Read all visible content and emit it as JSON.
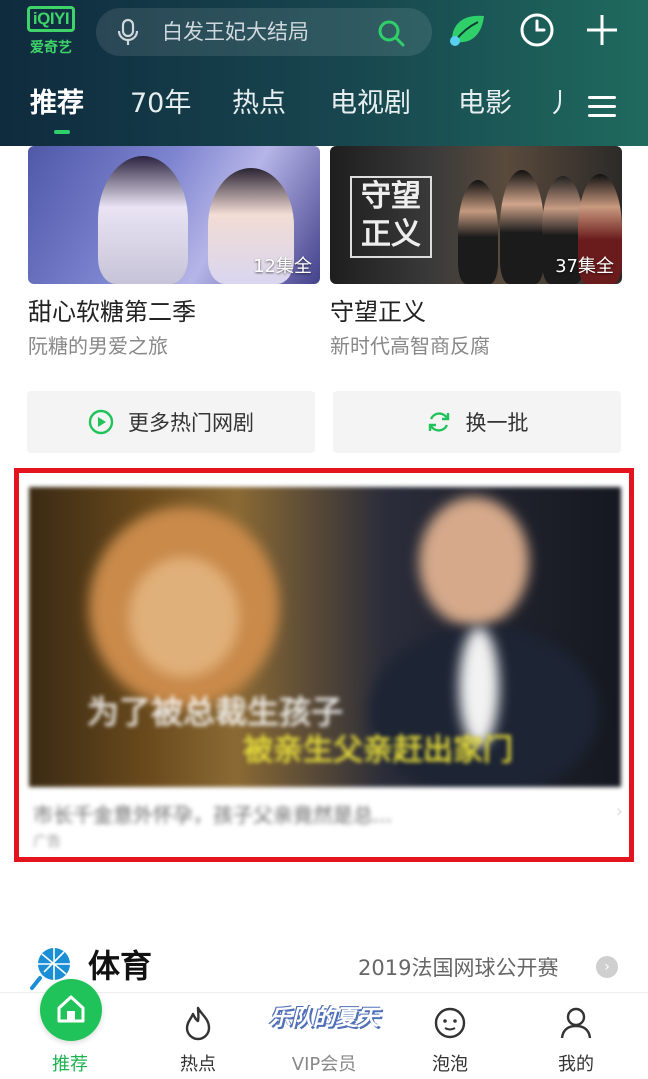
{
  "header": {
    "logo_text": "爱奇艺",
    "logo_mark": "iQIYI",
    "search_placeholder": "白发王妃大结局",
    "icons": [
      "mic-icon",
      "search-icon",
      "leaf-icon",
      "clock-icon",
      "plus-icon"
    ]
  },
  "tabs": [
    {
      "label": "推荐",
      "active": true
    },
    {
      "label": "70年",
      "active": false
    },
    {
      "label": "热点",
      "active": false
    },
    {
      "label": "电视剧",
      "active": false
    },
    {
      "label": "电影",
      "active": false
    },
    {
      "label": "儿",
      "active": false
    }
  ],
  "cards": [
    {
      "title": "甜心软糖第二季",
      "subtitle": "阮糖的男爱之旅",
      "episodes": "12集全"
    },
    {
      "title": "守望正义",
      "subtitle": "新时代高智商反腐",
      "episodes": "37集全",
      "poster_text": "守望正义"
    }
  ],
  "actions": {
    "more_label": "更多热门网剧",
    "refresh_label": "换一批"
  },
  "ad": {
    "caption_line1": "为了被总裁生孩子",
    "caption_line2": "被亲生父亲赶出家门",
    "description": "市长千金意外怀孕，孩子父亲竟然是总...",
    "tag": "广告",
    "highlight_color": "#e3141d"
  },
  "section": {
    "title": "体育",
    "link": "2019法国网球公开赛"
  },
  "bottom_nav": [
    {
      "label": "推荐",
      "icon": "home-icon",
      "active": true
    },
    {
      "label": "热点",
      "icon": "flame-icon",
      "active": false
    },
    {
      "label": "VIP会员",
      "icon": "vip-icon",
      "badge": "乐队的夏天",
      "active": false
    },
    {
      "label": "泡泡",
      "icon": "bubble-icon",
      "active": false
    },
    {
      "label": "我的",
      "icon": "profile-icon",
      "active": false
    }
  ],
  "colors": {
    "accent": "#20c35a",
    "header_bg_start": "#0f2b3e",
    "header_bg_end": "#1f6a5e"
  }
}
